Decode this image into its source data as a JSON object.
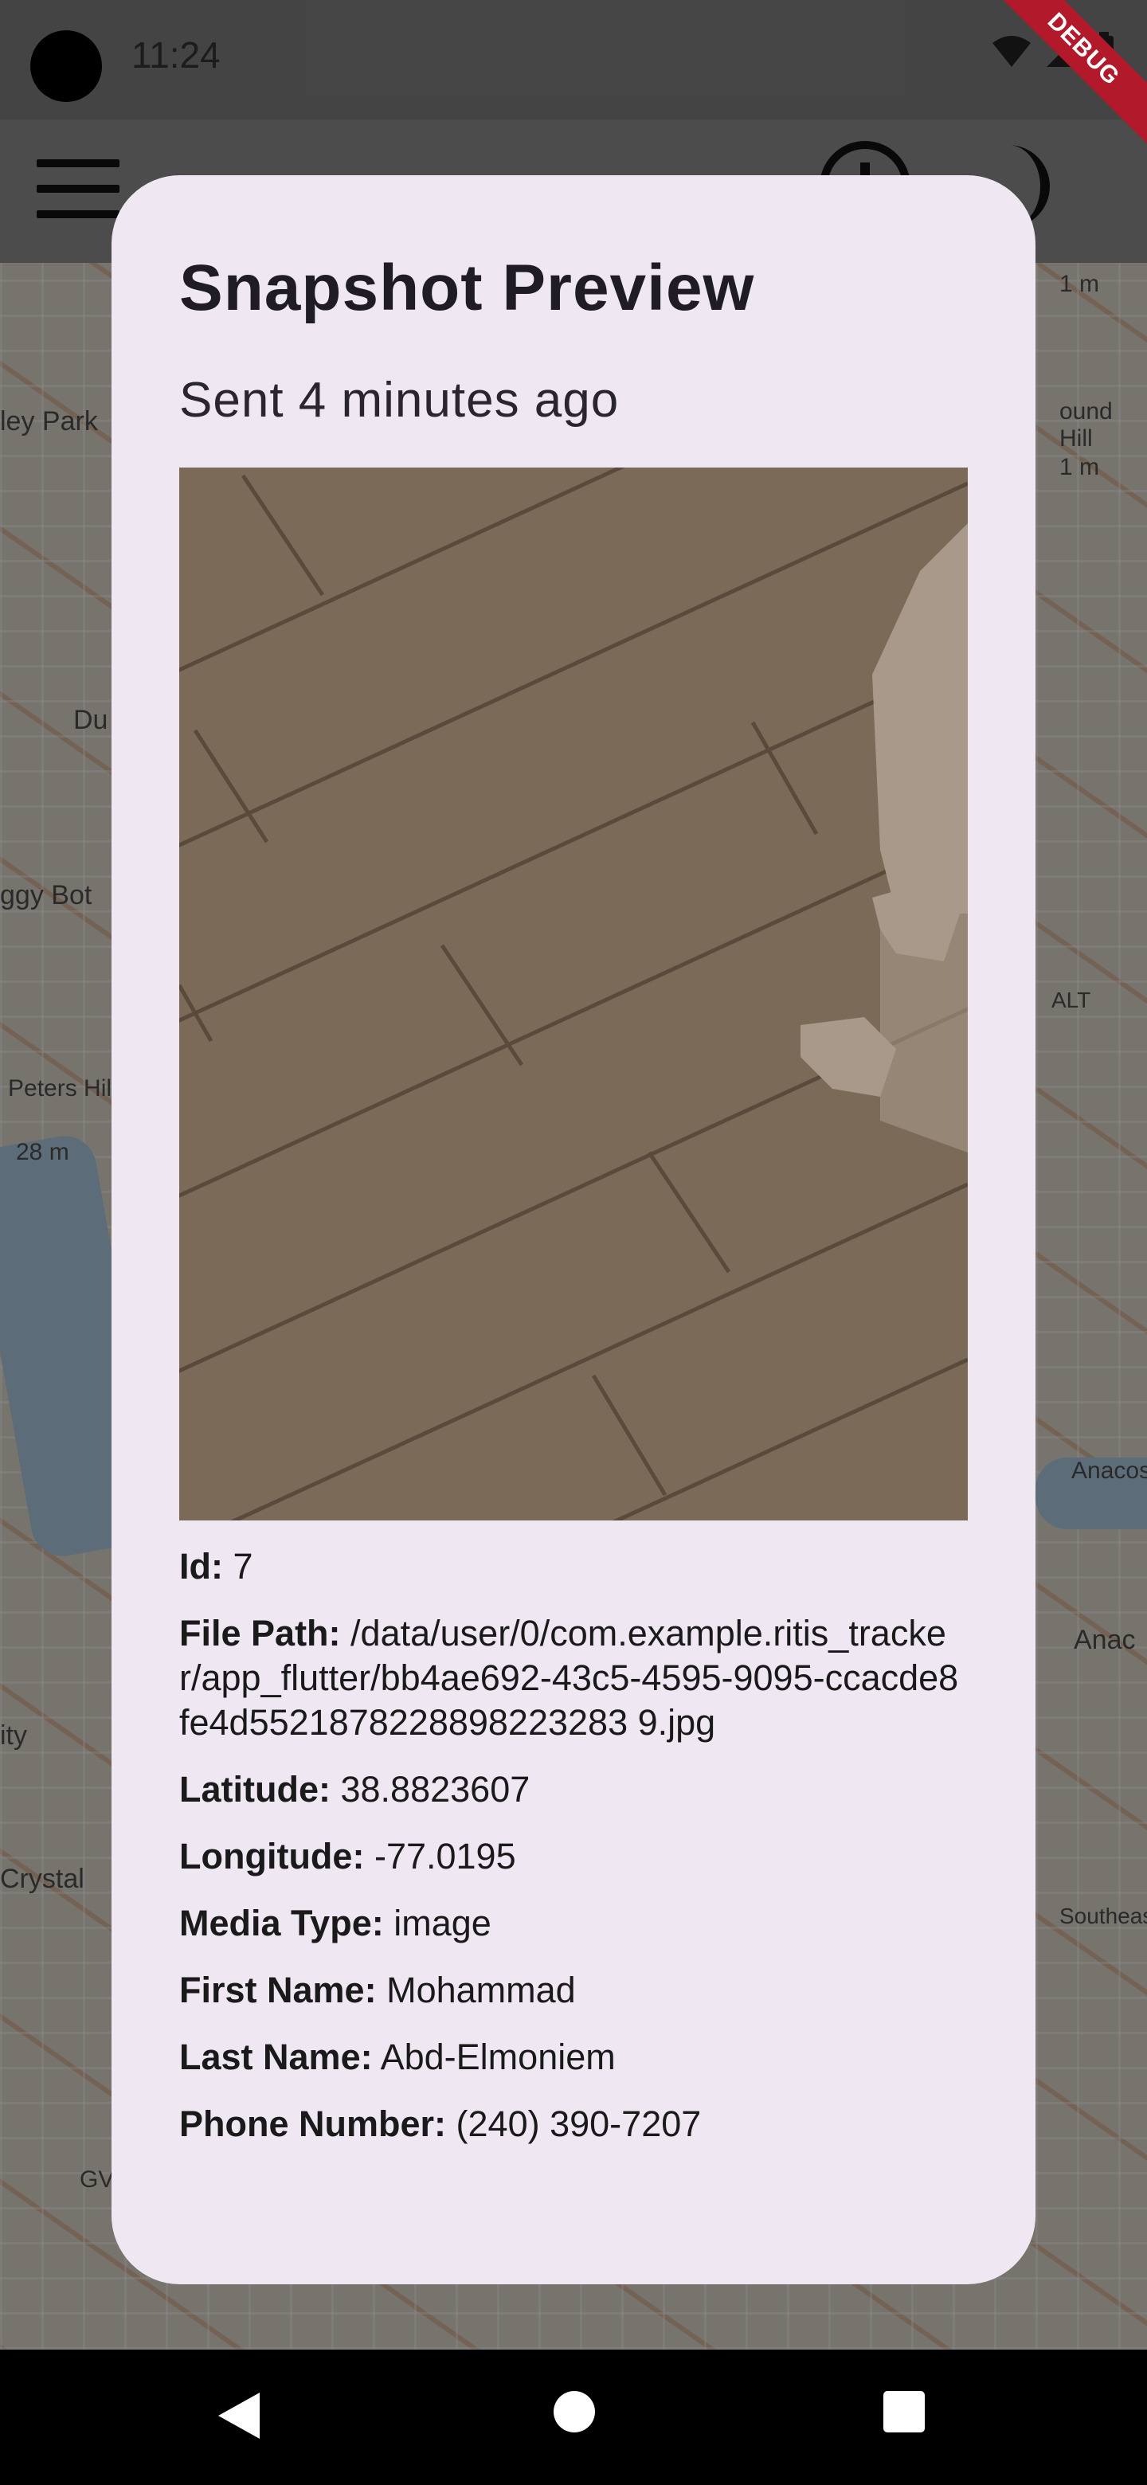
{
  "status_bar": {
    "time": "11:24",
    "debug_banner": "DEBUG"
  },
  "app_bar": {
    "menu_icon": "menu-icon",
    "info_icon": "info-icon",
    "theme_icon": "dark-mode-icon"
  },
  "map": {
    "labels": [
      "ley Park",
      "Du",
      "ggy Bot",
      "Peters Hill",
      "28 m",
      "1 m",
      "ound Hill",
      "1 m",
      "ALT",
      "Anacos",
      "Anac",
      "ity",
      "Crystal",
      "Southeast",
      "GV"
    ]
  },
  "dialog": {
    "title": "Snapshot Preview",
    "subtitle": "Sent 4 minutes ago",
    "fields": [
      {
        "label": "Id:",
        "value": "7"
      },
      {
        "label": "File Path:",
        "value": "/data/user/0/com.example.ritis_tracker/app_flutter/bb4ae692-43c5-4595-9095-ccacde8fe4d5521878228898223283 9.jpg"
      },
      {
        "label": "Latitude:",
        "value": "38.8823607"
      },
      {
        "label": "Longitude:",
        "value": "-77.0195"
      },
      {
        "label": "Media Type:",
        "value": "image"
      },
      {
        "label": "First Name:",
        "value": "Mohammad"
      },
      {
        "label": "Last Name:",
        "value": "Abd-Elmoniem"
      },
      {
        "label": "Phone Number:",
        "value": "(240) 390-7207"
      }
    ]
  },
  "nav_bar": {
    "back_icon": "back-icon",
    "home_icon": "home-icon",
    "recents_icon": "recents-icon"
  }
}
